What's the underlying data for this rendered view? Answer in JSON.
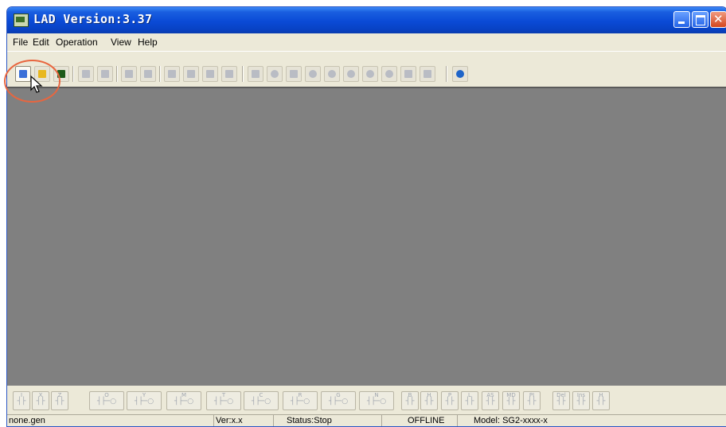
{
  "window": {
    "title": "LAD Version:3.37",
    "icon": "app-icon"
  },
  "menu": [
    "File",
    "Edit",
    "Operation",
    "View",
    "Help"
  ],
  "toolbar": {
    "buttons": [
      {
        "name": "new-file-icon",
        "color": "#3a6fd8",
        "enabled": true
      },
      {
        "name": "open-folder-icon",
        "color": "#e8b820",
        "enabled": true
      },
      {
        "name": "save-icon",
        "color": "#1d5a1a",
        "enabled": true
      },
      {
        "name": "print-icon",
        "color": "#b9bcc4",
        "enabled": false
      },
      {
        "name": "print-preview-icon",
        "color": "#b9bcc4",
        "enabled": false
      },
      {
        "name": "undo-icon",
        "color": "#b9bcc4",
        "enabled": false
      },
      {
        "name": "redo-icon",
        "color": "#b9bcc4",
        "enabled": false
      },
      {
        "name": "table-icon",
        "color": "#b9bcc4",
        "enabled": false
      },
      {
        "name": "tree-icon",
        "color": "#b9bcc4",
        "enabled": false
      },
      {
        "name": "grid-icon",
        "color": "#b9bcc4",
        "enabled": false
      },
      {
        "name": "list-icon",
        "color": "#b9bcc4",
        "enabled": false
      },
      {
        "name": "monitor-icon",
        "color": "#b9bcc4",
        "enabled": false
      },
      {
        "name": "stop-icon",
        "color": "#b9bcc4",
        "enabled": false
      },
      {
        "name": "tools-icon",
        "color": "#b9bcc4",
        "enabled": false
      },
      {
        "name": "run-icon",
        "color": "#b9bcc4",
        "enabled": false
      },
      {
        "name": "circle-icon",
        "color": "#b9bcc4",
        "enabled": false
      },
      {
        "name": "read-icon",
        "color": "#b9bcc4",
        "enabled": false
      },
      {
        "name": "write-icon",
        "color": "#b9bcc4",
        "enabled": false
      },
      {
        "name": "simulate-icon",
        "color": "#b9bcc4",
        "enabled": false
      },
      {
        "name": "upload-icon",
        "color": "#b9bcc4",
        "enabled": false
      },
      {
        "name": "download-icon",
        "color": "#b9bcc4",
        "enabled": false
      },
      {
        "name": "help-icon",
        "color": "#1e64c8",
        "enabled": true
      }
    ]
  },
  "ladder_toolbar": {
    "buttons": [
      "I",
      "X",
      "Z",
      "O",
      "Y",
      "M",
      "T",
      "C",
      "R",
      "G",
      "N",
      "B",
      "H",
      "P",
      "L",
      "AS",
      "MD",
      "PI",
      "Del",
      "Ins",
      "H"
    ]
  },
  "status": {
    "file": "none.gen",
    "version": "Ver:x.x",
    "state": "Status:Stop",
    "connection": "OFFLINE",
    "model": "Model: SG2-xxxx-x"
  },
  "colors": {
    "title_bar": "#0a4ad6",
    "workspace": "#808080",
    "highlight_ring": "#e8663f"
  }
}
